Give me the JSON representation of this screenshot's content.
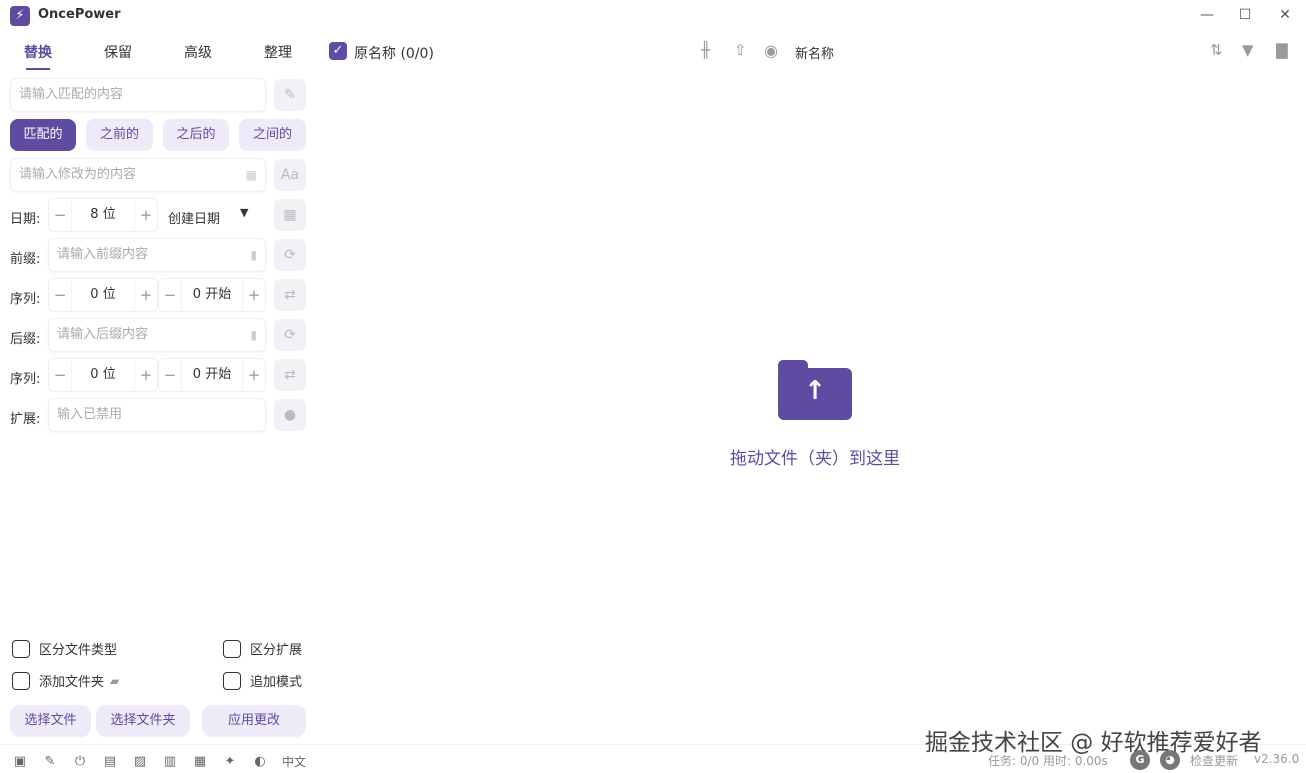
{
  "app": {
    "title": "OncePower",
    "version": "v2.36.0"
  },
  "window_controls": [
    "minimize",
    "maximize",
    "close"
  ],
  "tabs": [
    {
      "label": "替换",
      "active": true
    },
    {
      "label": "保留",
      "active": false
    },
    {
      "label": "高级",
      "active": false
    },
    {
      "label": "整理",
      "active": false
    }
  ],
  "replace": {
    "match_placeholder": "请输入匹配的内容",
    "modes": [
      "匹配的",
      "之前的",
      "之后的",
      "之间的"
    ],
    "active_mode": "匹配的",
    "replace_placeholder": "请输入修改为的内容"
  },
  "date": {
    "label": "日期:",
    "digits": "8 位",
    "type": "创建日期"
  },
  "prefix": {
    "label": "前缀:",
    "placeholder": "请输入前缀内容"
  },
  "prefix_seq": {
    "label": "序列:",
    "digits": "0 位",
    "start": "0 开始"
  },
  "suffix": {
    "label": "后缀:",
    "placeholder": "请输入后缀内容"
  },
  "suffix_seq": {
    "label": "序列:",
    "digits": "0 位",
    "start": "0 开始"
  },
  "extension": {
    "label": "扩展:",
    "placeholder": "输入已禁用"
  },
  "options": {
    "distinguish_type": "区分文件类型",
    "distinguish_ext": "区分扩展",
    "add_folder": "添加文件夹",
    "append_mode": "追加模式"
  },
  "buttons": {
    "select_file": "选择文件",
    "select_folder": "选择文件夹",
    "apply": "应用更改"
  },
  "footer_lang": "中文",
  "list_header": {
    "original": "原名称 (0/0)",
    "new": "新名称"
  },
  "drop_text": "拖动文件（夹）到这里",
  "status": "任务: 0/0  用时: 0.00s",
  "check_update": "检查更新",
  "watermark": "掘金技术社区 @ 好软推荐爱好者",
  "colors": {
    "accent": "#5f4ba0",
    "accent_light": "#efeaf7"
  }
}
